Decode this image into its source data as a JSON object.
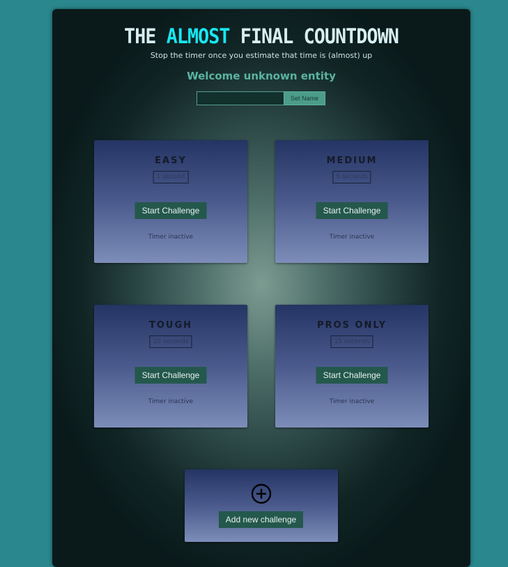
{
  "header": {
    "title_prefix": "THE ",
    "title_accent": "ALMOST",
    "title_suffix": " FINAL COUNTDOWN",
    "subtitle": "Stop the timer once you estimate that time is (almost) up",
    "accent_color": "#18e6f2"
  },
  "welcome": {
    "message": "Welcome unknown entity",
    "name_input_value": "",
    "set_name_label": "Set Name"
  },
  "challenges": [
    {
      "title": "EASY",
      "duration": "1 second",
      "button": "Start Challenge",
      "status": "Timer inactive"
    },
    {
      "title": "MEDIUM",
      "duration": "5 seconds",
      "button": "Start Challenge",
      "status": "Timer inactive"
    },
    {
      "title": "TOUGH",
      "duration": "10 seconds",
      "button": "Start Challenge",
      "status": "Timer inactive"
    },
    {
      "title": "PROS ONLY",
      "duration": "15 seconds",
      "button": "Start Challenge",
      "status": "Timer inactive"
    }
  ],
  "add_challenge": {
    "icon": "plus-circle-icon",
    "button_label": "Add new challenge"
  },
  "colors": {
    "page_background": "#2a878d",
    "button": "#24584c",
    "welcome_text": "#5ab3a2"
  }
}
